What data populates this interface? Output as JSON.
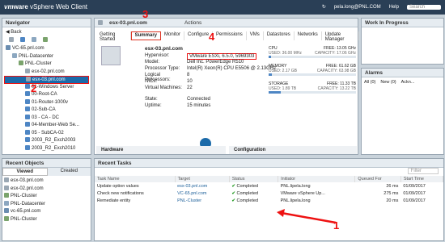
{
  "header": {
    "brand_vm": "vm",
    "brand_ware": "ware",
    "brand_rest": "vSphere Web Client",
    "user": "pela.long@PNL.COM",
    "help": "Help",
    "search_placeholder": "Search"
  },
  "navigator": {
    "title": "Navigator",
    "back": "Back",
    "items": [
      "VC-65.pnl.com",
      "PNL-Datacenter",
      "PNL-Cluster",
      "esx-02.pnl.com",
      "esx-03.pnl.com",
      "01-Windows Server",
      "00-Root-CA",
      "01-Router-1000v",
      "02-Sub-CA",
      "03 - CA - DC",
      "04-Member-Web Se...",
      "05 - SubCA-02",
      "2003_R2_Exch2003",
      "2003_R2_Exch2010"
    ]
  },
  "main": {
    "host": "esx-03.pnl.com",
    "actions": "Actions",
    "tabs": [
      "Getting Started",
      "Summary",
      "Monitor",
      "Configure",
      "Permissions",
      "VMs",
      "Datastores",
      "Networks",
      "Update Manager"
    ],
    "summary": {
      "name": "esx-03.pnl.com",
      "rows": [
        [
          "Hypervisor:",
          "VMware ESXi, 6.5.0, 5969303"
        ],
        [
          "Model:",
          "Dell Inc. PowerEdge R510"
        ],
        [
          "Processor Type:",
          "Intel(R) Xeon(R) CPU E5506 @ 2.13GHz"
        ],
        [
          "Logical Processors:",
          "8"
        ],
        [
          "NICs:",
          "10"
        ],
        [
          "Virtual Machines:",
          "22"
        ],
        [
          "State:",
          "Connected"
        ],
        [
          "Uptime:",
          "15 minutes"
        ]
      ],
      "res": [
        [
          "CPU",
          "FREE: 13.05 GHz",
          "USED: 36.00 MHz",
          "CAPACITY: 17.06 GHz"
        ],
        [
          "MEMORY",
          "FREE: 61.62 GB",
          "USED: 2.17 GB",
          "CAPACITY: 63.98 GB"
        ],
        [
          "STORAGE",
          "FREE: 11.33 TB",
          "USED: 1.89 TB",
          "CAPACITY: 13.22 TB"
        ]
      ]
    },
    "hardware": "Hardware",
    "configuration": "Configuration"
  },
  "wip": {
    "title": "Work In Progress"
  },
  "alarms": {
    "title": "Alarms",
    "tabs": [
      "All (0)",
      "New (0)",
      "Ackn..."
    ]
  },
  "recent": {
    "title": "Recent Objects",
    "tabs": [
      "Viewed",
      "Created"
    ],
    "items": [
      "esx-03.pnl.com",
      "esx-02.pnl.com",
      "PNL-Cluster",
      "PNL-Datacenter",
      "vc-65.pnl.com",
      "PNL-Cluster"
    ]
  },
  "tasks": {
    "title": "Recent Tasks",
    "filter": "Filter",
    "cols": [
      "Task Name",
      "Target",
      "Status",
      "Initiator",
      "Queued For",
      "Start Time"
    ],
    "rows": [
      [
        "Update option values",
        "esx-03.pnl.com",
        "Completed",
        "PNL.lipela.long",
        "26 ms",
        "01/09/2017"
      ],
      [
        "Check new notifications",
        "VC-65.pnl.com",
        "Completed",
        "VMware vSphere Up...",
        "275 ms",
        "01/09/2017"
      ],
      [
        "Remediate entity",
        "PNL-Cluster",
        "Completed",
        "PNL.lipela.long",
        "20 ms",
        "01/09/2017"
      ]
    ]
  },
  "annotations": [
    "3",
    "4",
    "2",
    "1"
  ]
}
